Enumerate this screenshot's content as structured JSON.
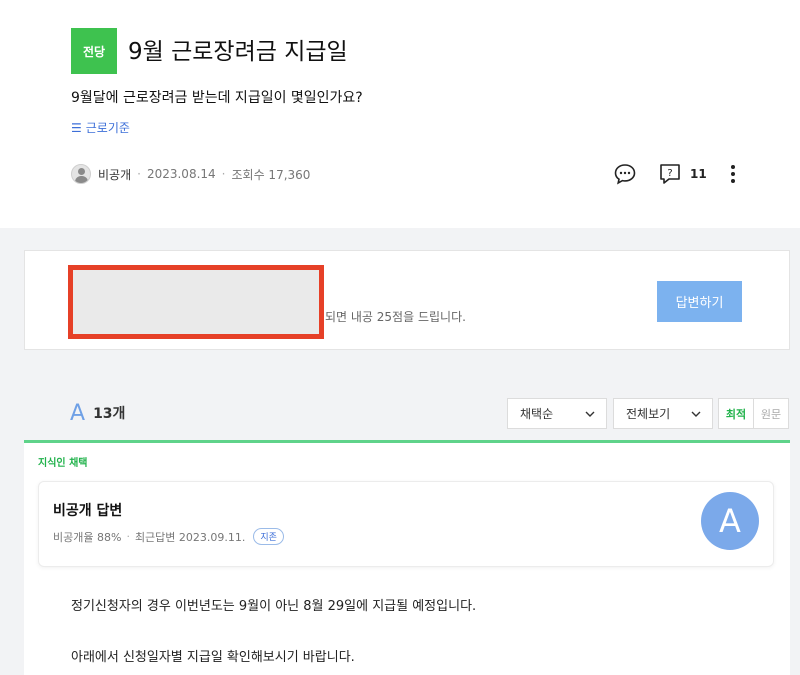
{
  "question": {
    "badge": "전당",
    "title": "9월 근로장려금 지급일",
    "body": "9월달에 근로장려금 받는데 지급일이 몇일인가요?",
    "tag_icon": "list-icon",
    "tag": "근로기준",
    "author": "비공개",
    "date": "2023.08.14",
    "views_label": "조회수 17,360",
    "answer_count": "11"
  },
  "invite": {
    "text": "되면 내공 25점을 드립니다.",
    "button": "답변하기"
  },
  "answers": {
    "logo": "A",
    "count_label": "13개",
    "sort_select": "채택순",
    "filter_select": "전체보기",
    "sort_latest": "최적",
    "sort_original": "원문"
  },
  "answer": {
    "adopted_label": "지식인 채택",
    "author": "비공개 답변",
    "adoption_rate": "비공개율 88%",
    "recent_answer": "최근답변 2023.09.11.",
    "badge": "지존",
    "avatar_letter": "A",
    "paragraphs": [
      "정기신청자의 경우 이번년도는 9월이 아닌 8월 29일에 지급될 예정입니다.",
      "아래에서 신청일자별 지급일 확인해보시기 바랍니다."
    ]
  },
  "colors": {
    "badge_green": "#3ec24f",
    "accent_blue": "#7cb2ef",
    "adopt_green": "#5fd38a",
    "redact_red": "#e64027"
  }
}
